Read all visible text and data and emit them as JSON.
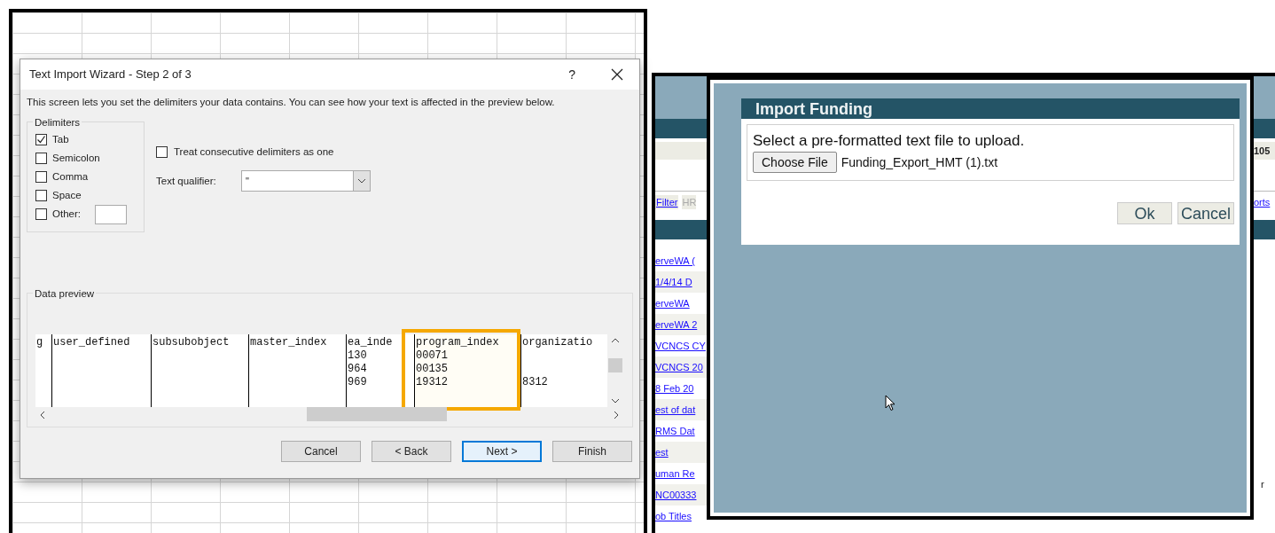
{
  "excel_wizard": {
    "title": "Text Import Wizard - Step 2 of 3",
    "help": "?",
    "description": "This screen lets you set the delimiters your data contains.  You can see how your text is affected in the preview below.",
    "delimiters_label": "Delimiters",
    "delimiters": [
      {
        "label": "Tab",
        "checked": true,
        "kind": "plain"
      },
      {
        "label": "Semicolon",
        "checked": false,
        "kind": "plain"
      },
      {
        "label": "Comma",
        "checked": false,
        "kind": "plain"
      },
      {
        "label": "Space",
        "checked": false,
        "kind": "plain"
      },
      {
        "label": "Other:",
        "checked": false,
        "kind": "other"
      }
    ],
    "consecutive": {
      "label": "Treat consecutive delimiters as one",
      "checked": false
    },
    "qualifier_label": "Text qualifier:",
    "qualifier_value": "\"",
    "preview_label": "Data preview",
    "preview_columns": [
      {
        "header": "g",
        "highlighted": false
      },
      {
        "header": "user_defined",
        "highlighted": false
      },
      {
        "header": "subsubobject",
        "highlighted": false
      },
      {
        "header": "master_index",
        "highlighted": false
      },
      {
        "header": "ea_inde",
        "values": [
          "130",
          "964",
          "969"
        ],
        "highlighted": false
      },
      {
        "header": "program_index",
        "values": [
          "00071",
          "00135",
          "19312"
        ],
        "highlighted": true
      },
      {
        "header": "organizatio",
        "values": [
          "8312"
        ],
        "highlighted": false
      }
    ],
    "buttons": [
      {
        "label": "Cancel",
        "default": false
      },
      {
        "label": "< Back",
        "default": false
      },
      {
        "label": "Next >",
        "default": true
      },
      {
        "label": "Finish",
        "default": false
      }
    ]
  },
  "web_page": {
    "left_links": [
      "erveWA (",
      "1/4/14 D",
      "erveWA",
      "erveWA 2",
      "VCNCS CY",
      "VCNCS 20",
      "8 Feb 20",
      "est of dat",
      "RMS Dat",
      "est",
      "uman Re",
      "NC00333",
      "ob Titles"
    ],
    "filter_link": "Filter",
    "filter_tag": "HR",
    "right_count": "105",
    "right_link": "orts",
    "right_letter": "r",
    "modal": {
      "title": "Import Funding",
      "prompt": "Select a pre-formatted text file to upload.",
      "choose_button": "Choose File",
      "file_name": "Funding_Export_HMT (1).txt",
      "buttons": [
        "Ok",
        "Cancel"
      ]
    }
  }
}
